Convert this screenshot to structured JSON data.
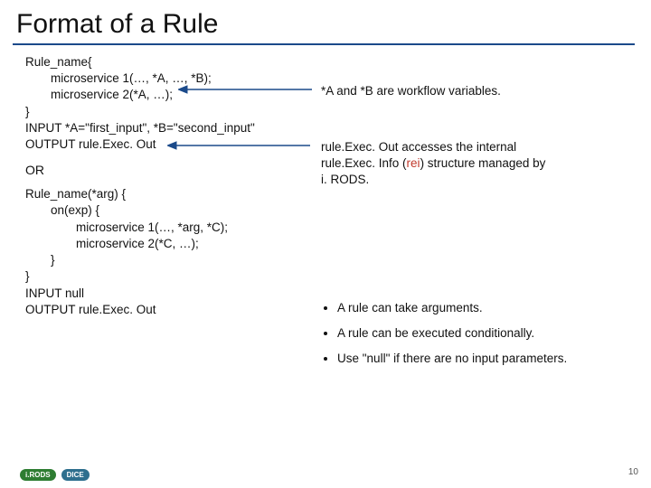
{
  "title": "Format of a Rule",
  "block1": {
    "l1": "Rule_name{",
    "l2": "microservice 1(…, *A, …, *B);",
    "l3": "microservice 2(*A, …);",
    "l4": "}",
    "l5": "INPUT *A=\"first_input\", *B=\"second_input\"",
    "l6": "OUTPUT rule.Exec. Out"
  },
  "or": "OR",
  "block2": {
    "l1": "Rule_name(*arg) {",
    "l2": "on(exp) {",
    "l3": "microservice 1(…, *arg, *C);",
    "l4": "microservice 2(*C, …);",
    "l5": "}",
    "l6": "}",
    "l7": "INPUT null",
    "l8": "OUTPUT rule.Exec. Out"
  },
  "notes": {
    "workflow": "*A and *B are workflow variables.",
    "exec_pre": "rule.Exec. Out accesses the internal rule.Exec. Info (",
    "exec_rei": "rei",
    "exec_post": ") structure managed by i. RODS."
  },
  "bullets": {
    "b1": "A rule can take arguments.",
    "b2": "A rule can be executed conditionally.",
    "b3": "Use \"null\" if there are no input parameters."
  },
  "badges": {
    "irods": "i.RODS",
    "dice": "DICE"
  },
  "pagenum": "10"
}
